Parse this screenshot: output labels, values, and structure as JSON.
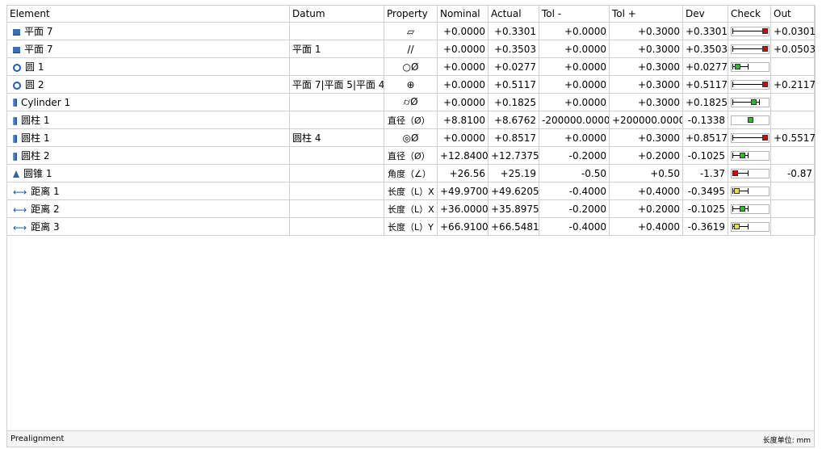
{
  "columns": [
    "Element",
    "Datum",
    "Property",
    "Nominal",
    "Actual",
    "Tol -",
    "Tol +",
    "Dev",
    "Check",
    "Out"
  ],
  "rows": [
    {
      "icon": "plane-icon",
      "element": "平面 7",
      "datum": "",
      "property": "▱",
      "nominal": "+0.0000",
      "actual": "+0.3301",
      "tol_minus": "+0.0000",
      "tol_plus": "+0.3000",
      "dev": "+0.3301",
      "out": "+0.0301",
      "check": {
        "level": 1.0,
        "status": "red"
      }
    },
    {
      "icon": "plane-icon",
      "element": "平面 7",
      "datum": "平面 1",
      "property": "//",
      "nominal": "+0.0000",
      "actual": "+0.3503",
      "tol_minus": "+0.0000",
      "tol_plus": "+0.3000",
      "dev": "+0.3503",
      "out": "+0.0503",
      "check": {
        "level": 1.0,
        "status": "red"
      }
    },
    {
      "icon": "circle-icon",
      "element": "圆 1",
      "datum": "",
      "property": "○Ø",
      "nominal": "+0.0000",
      "actual": "+0.0277",
      "tol_minus": "+0.0000",
      "tol_plus": "+0.3000",
      "dev": "+0.0277",
      "out": "",
      "check": {
        "level": 0.09,
        "status": "green"
      }
    },
    {
      "icon": "circle-icon",
      "element": "圆 2",
      "datum": "平面 7|平面 5|平面 4",
      "property": "⊕",
      "nominal": "+0.0000",
      "actual": "+0.5117",
      "tol_minus": "+0.0000",
      "tol_plus": "+0.3000",
      "dev": "+0.5117",
      "out": "+0.2117",
      "check": {
        "level": 1.0,
        "status": "red"
      }
    },
    {
      "icon": "cylinder-icon",
      "element": "Cylinder 1",
      "datum": "",
      "property": "⌭Ø",
      "nominal": "+0.0000",
      "actual": "+0.1825",
      "tol_minus": "+0.0000",
      "tol_plus": "+0.3000",
      "dev": "+0.1825",
      "out": "",
      "check": {
        "level": 0.61,
        "status": "green"
      }
    },
    {
      "icon": "cylinder-icon",
      "element": "圆柱 1",
      "datum": "",
      "property": "直径（Ø）",
      "nominal": "+8.8100",
      "actual": "+8.6762",
      "tol_minus": "-200000.0000",
      "tol_plus": "+200000.0000",
      "dev": "-0.1338",
      "out": "",
      "check": {
        "level": 0.5,
        "status": "green",
        "centered": true
      }
    },
    {
      "icon": "cylinder-icon",
      "element": "圆柱 1",
      "datum": "圆柱 4",
      "property": "◎Ø",
      "nominal": "+0.0000",
      "actual": "+0.8517",
      "tol_minus": "+0.0000",
      "tol_plus": "+0.3000",
      "dev": "+0.8517",
      "out": "+0.5517",
      "check": {
        "level": 1.0,
        "status": "red"
      }
    },
    {
      "icon": "cylinder-icon",
      "element": "圆柱 2",
      "datum": "",
      "property": "直径（Ø）",
      "nominal": "+12.8400",
      "actual": "+12.7375",
      "tol_minus": "-0.2000",
      "tol_plus": "+0.2000",
      "dev": "-0.1025",
      "out": "",
      "check": {
        "level": 0.24,
        "status": "green"
      }
    },
    {
      "icon": "cone-icon",
      "element": "圆锥 1",
      "datum": "",
      "property": "角度（∠）",
      "nominal": "+26.56",
      "actual": "+25.19",
      "tol_minus": "-0.50",
      "tol_plus": "+0.50",
      "dev": "-1.37",
      "out": "-0.87",
      "check": {
        "level": 0.0,
        "status": "red"
      }
    },
    {
      "icon": "distance-icon",
      "element": "距离 1",
      "datum": "",
      "property": "长度（L）X",
      "nominal": "+49.9700",
      "actual": "+49.6205",
      "tol_minus": "-0.4000",
      "tol_plus": "+0.4000",
      "dev": "-0.3495",
      "out": "",
      "check": {
        "level": 0.06,
        "status": "yellow"
      }
    },
    {
      "icon": "distance-icon",
      "element": "距离 2",
      "datum": "",
      "property": "长度（L）X",
      "nominal": "+36.0000",
      "actual": "+35.8975",
      "tol_minus": "-0.2000",
      "tol_plus": "+0.2000",
      "dev": "-0.1025",
      "out": "",
      "check": {
        "level": 0.24,
        "status": "green"
      }
    },
    {
      "icon": "distance-icon",
      "element": "距离 3",
      "datum": "",
      "property": "长度（L）Y",
      "nominal": "+66.9100",
      "actual": "+66.5481",
      "tol_minus": "-0.4000",
      "tol_plus": "+0.4000",
      "dev": "-0.3619",
      "out": "",
      "check": {
        "level": 0.05,
        "status": "yellow"
      }
    }
  ],
  "status_colors": {
    "red": "#e00000",
    "green": "#19c819",
    "yellow": "#e8e04a"
  },
  "footer": {
    "left": "Prealignment",
    "right": "长度单位: mm"
  }
}
